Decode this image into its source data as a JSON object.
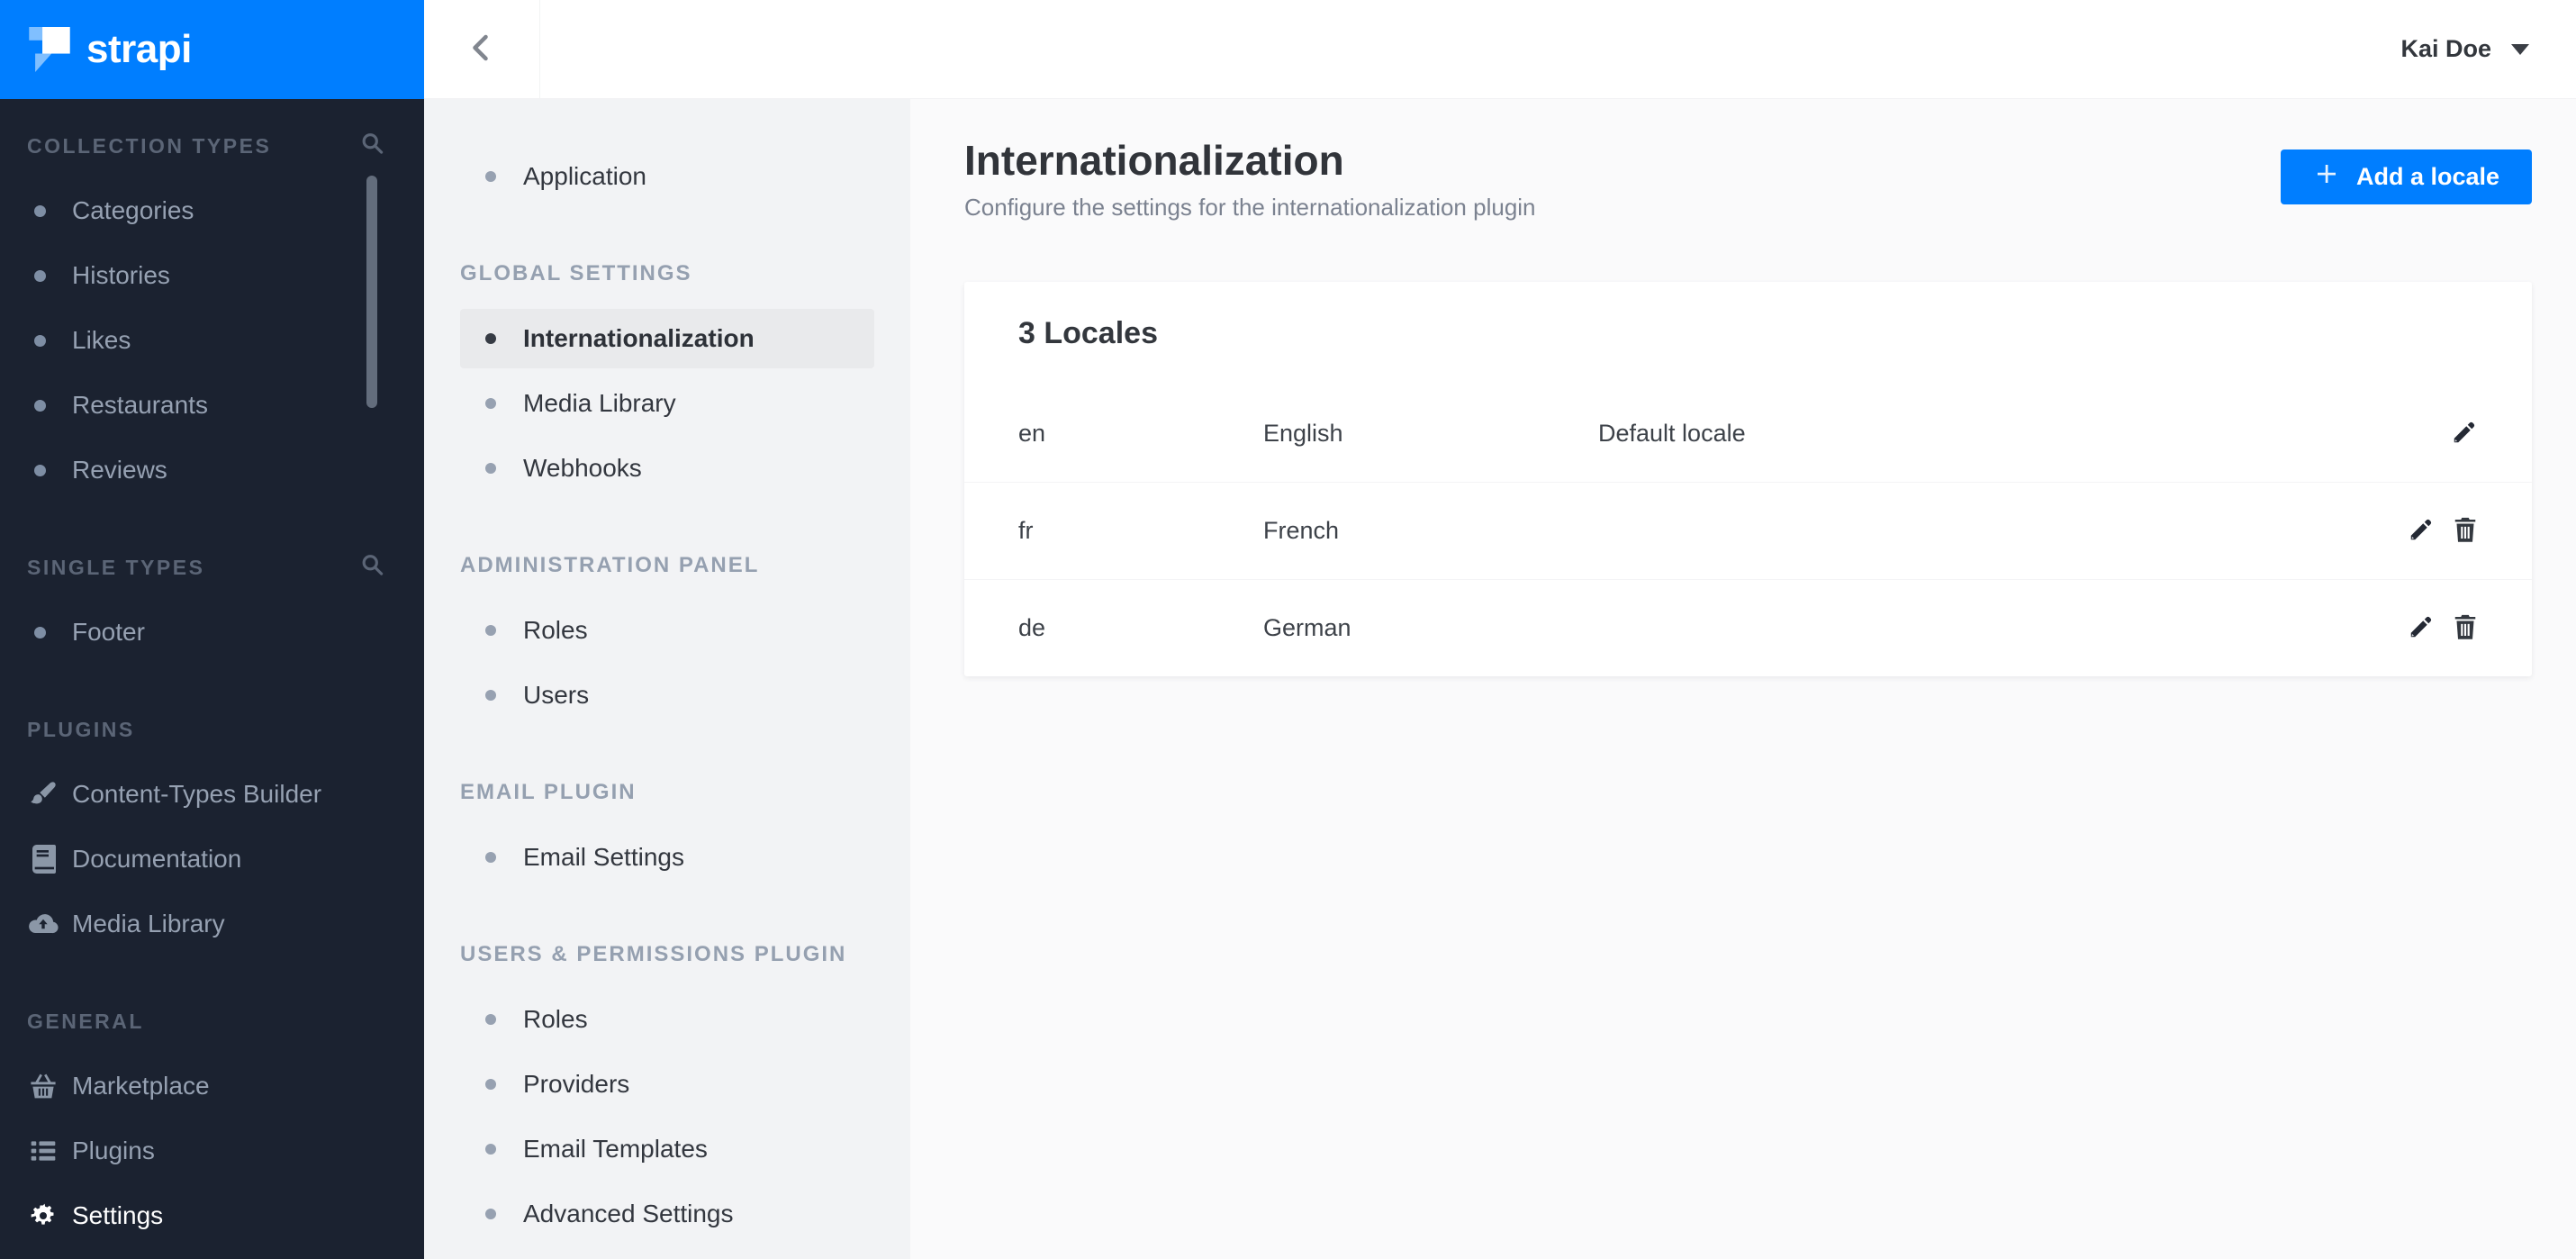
{
  "brand": {
    "name": "strapi",
    "accent_color": "#007eff",
    "sidebar_bg": "#1b2230"
  },
  "topbar": {
    "user_name": "Kai Doe"
  },
  "main_sidebar": {
    "sections": [
      {
        "label": "COLLECTION TYPES",
        "has_search": true,
        "items": [
          {
            "label": "Categories"
          },
          {
            "label": "Histories"
          },
          {
            "label": "Likes"
          },
          {
            "label": "Restaurants"
          },
          {
            "label": "Reviews"
          }
        ]
      },
      {
        "label": "SINGLE TYPES",
        "has_search": true,
        "items": [
          {
            "label": "Footer"
          }
        ]
      },
      {
        "label": "PLUGINS",
        "items": [
          {
            "label": "Content-Types Builder",
            "icon": "brush-icon"
          },
          {
            "label": "Documentation",
            "icon": "book-icon"
          },
          {
            "label": "Media Library",
            "icon": "cloud-upload-icon"
          }
        ]
      },
      {
        "label": "GENERAL",
        "items": [
          {
            "label": "Marketplace",
            "icon": "basket-icon"
          },
          {
            "label": "Plugins",
            "icon": "list-icon"
          },
          {
            "label": "Settings",
            "icon": "gear-icon",
            "active": true
          }
        ]
      }
    ]
  },
  "settings_nav": {
    "top_items": [
      {
        "label": "Application"
      }
    ],
    "sections": [
      {
        "label": "GLOBAL SETTINGS",
        "items": [
          {
            "label": "Internationalization",
            "active": true
          },
          {
            "label": "Media Library"
          },
          {
            "label": "Webhooks"
          }
        ]
      },
      {
        "label": "ADMINISTRATION PANEL",
        "items": [
          {
            "label": "Roles"
          },
          {
            "label": "Users"
          }
        ]
      },
      {
        "label": "EMAIL PLUGIN",
        "items": [
          {
            "label": "Email Settings"
          }
        ]
      },
      {
        "label": "USERS & PERMISSIONS PLUGIN",
        "items": [
          {
            "label": "Roles"
          },
          {
            "label": "Providers"
          },
          {
            "label": "Email Templates"
          },
          {
            "label": "Advanced Settings"
          }
        ]
      }
    ]
  },
  "page": {
    "title": "Internationalization",
    "subtitle": "Configure the settings for the internationalization plugin",
    "add_button_label": "Add a locale"
  },
  "locales": {
    "heading": "3 Locales",
    "rows": [
      {
        "code": "en",
        "name": "English",
        "default_label": "Default locale",
        "can_delete": false
      },
      {
        "code": "fr",
        "name": "French",
        "default_label": "",
        "can_delete": true
      },
      {
        "code": "de",
        "name": "German",
        "default_label": "",
        "can_delete": true
      }
    ]
  },
  "colors": {
    "accent": "#007eff",
    "sidebar_bg": "#1b2230",
    "subnav_bg": "#f2f3f5",
    "subnav_active_bg": "#e9eaec",
    "card_bg": "#ffffff",
    "main_bg": "#fafafb"
  }
}
